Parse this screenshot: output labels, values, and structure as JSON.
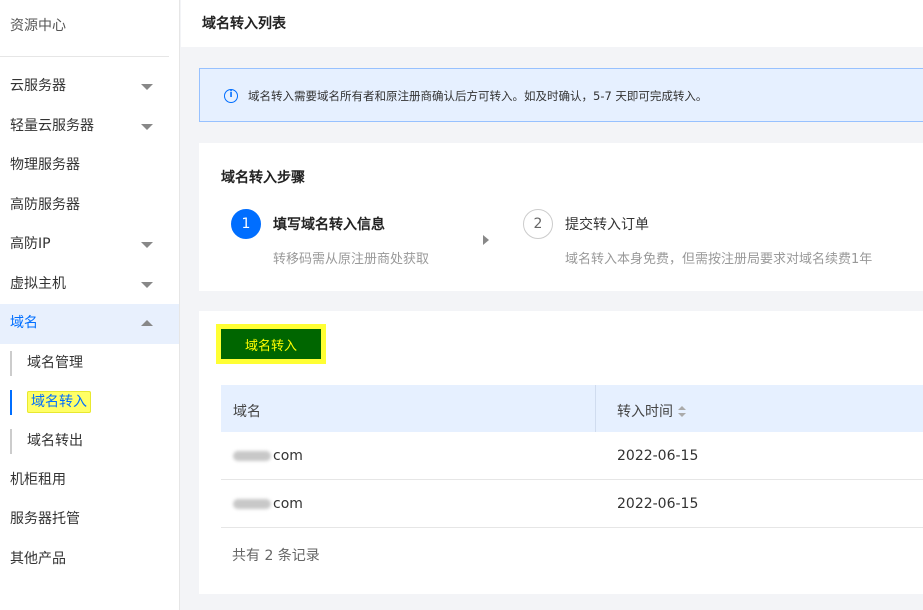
{
  "sidebar": {
    "top": "资源中心",
    "items": [
      {
        "label": "云服务器"
      },
      {
        "label": "轻量云服务器"
      },
      {
        "label": "物理服务器"
      },
      {
        "label": "高防服务器"
      },
      {
        "label": "高防IP"
      },
      {
        "label": "虚拟主机"
      },
      {
        "label": "域名"
      }
    ],
    "sub_items": [
      {
        "label": "域名管理"
      },
      {
        "label": "域名转入"
      },
      {
        "label": "域名转出"
      }
    ],
    "bottom_items": [
      {
        "label": "机柜租用"
      },
      {
        "label": "服务器托管"
      },
      {
        "label": "其他产品"
      }
    ]
  },
  "header": {
    "title": "域名转入列表"
  },
  "notice": {
    "text": "域名转入需要域名所有者和原注册商确认后方可转入。如及时确认，5-7 天即可完成转入。"
  },
  "steps": {
    "title": "域名转入步骤",
    "step1": {
      "num": "1",
      "title": "填写域名转入信息",
      "desc": "转移码需从原注册商处获取"
    },
    "step2": {
      "num": "2",
      "title": "提交转入订单",
      "desc": "域名转入本身免费，但需按注册局要求对域名续费1年"
    }
  },
  "list": {
    "button_label": "域名转入",
    "columns": {
      "domain": "域名",
      "time": "转入时间"
    },
    "rows": [
      {
        "domain_suffix": "com",
        "time": "2022-06-15"
      },
      {
        "domain_suffix": "com",
        "time": "2022-06-15"
      }
    ],
    "footer": "共有 2 条记录"
  },
  "colors": {
    "accent": "#006eff",
    "highlight": "#ffff33",
    "button_bg": "#006600"
  }
}
